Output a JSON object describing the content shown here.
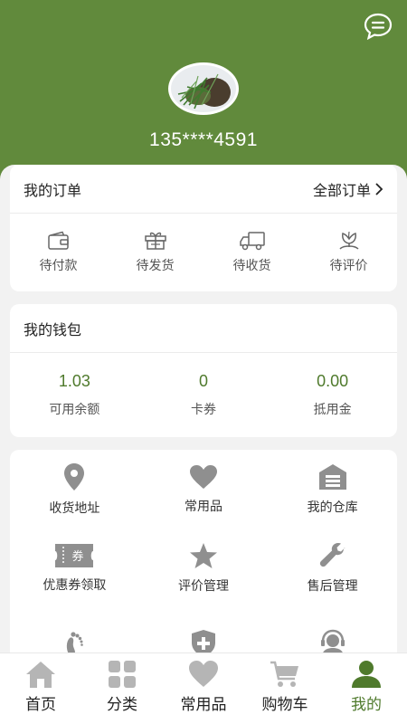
{
  "header": {
    "phone": "135****4591"
  },
  "orders": {
    "title": "我的订单",
    "all_label": "全部订单",
    "items": [
      {
        "label": "待付款",
        "icon": "wallet-icon"
      },
      {
        "label": "待发货",
        "icon": "gift-box-icon"
      },
      {
        "label": "待收货",
        "icon": "truck-icon"
      },
      {
        "label": "待评价",
        "icon": "flower-icon"
      }
    ]
  },
  "wallet": {
    "title": "我的钱包",
    "items": [
      {
        "value": "1.03",
        "label": "可用余额"
      },
      {
        "value": "0",
        "label": "卡券"
      },
      {
        "value": "0.00",
        "label": "抵用金"
      }
    ]
  },
  "services": {
    "items": [
      {
        "label": "收货地址",
        "icon": "location-pin-icon"
      },
      {
        "label": "常用品",
        "icon": "heart-icon"
      },
      {
        "label": "我的仓库",
        "icon": "warehouse-icon"
      },
      {
        "label": "优惠券领取",
        "icon": "coupon-icon",
        "badge": "券"
      },
      {
        "label": "评价管理",
        "icon": "star-icon"
      },
      {
        "label": "售后管理",
        "icon": "wrench-icon"
      },
      {
        "label": "",
        "icon": "footprint-icon"
      },
      {
        "label": "",
        "icon": "shield-plus-icon"
      },
      {
        "label": "",
        "icon": "customer-service-icon"
      }
    ]
  },
  "tabbar": {
    "items": [
      {
        "label": "首页",
        "icon": "home-icon"
      },
      {
        "label": "分类",
        "icon": "grid-icon"
      },
      {
        "label": "常用品",
        "icon": "heart-icon"
      },
      {
        "label": "购物车",
        "icon": "cart-icon"
      },
      {
        "label": "我的",
        "icon": "user-icon",
        "active": true
      }
    ]
  },
  "colors": {
    "brand": "#618a3c",
    "accent": "#4f7a2c",
    "icon_gray": "#8f8f8f"
  }
}
